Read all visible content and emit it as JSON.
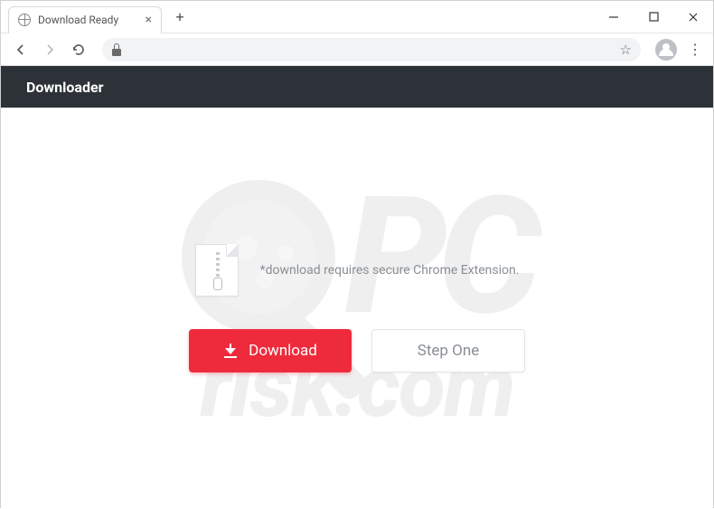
{
  "browser": {
    "tab_title": "Download Ready",
    "new_tab_glyph": "+",
    "star_glyph": "☆",
    "kebab_glyph": "⋮"
  },
  "page": {
    "header_title": "Downloader",
    "info_text": "*download requires secure Chrome Extension.",
    "download_label": "Download",
    "step_one_label": "Step One"
  },
  "watermark": {
    "top_text": "PC",
    "bottom_text": "risk.com"
  }
}
